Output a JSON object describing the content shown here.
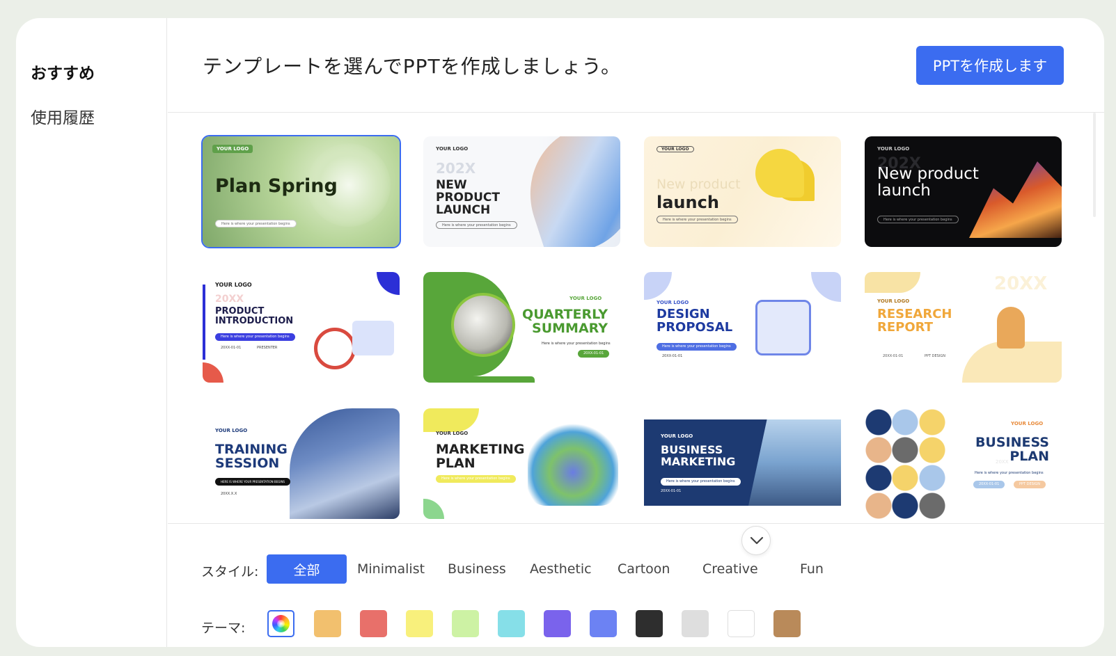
{
  "sidebar": {
    "items": [
      {
        "label": "おすすめ"
      },
      {
        "label": "使用履歴"
      }
    ]
  },
  "header": {
    "title": "テンプレートを選んでPPTを作成しましょう。",
    "create_button": "PPTを作成します"
  },
  "templates": [
    {
      "logo": "YOUR LOGO",
      "title": "Plan Spring",
      "subtitle": "Here is where your presentation begins"
    },
    {
      "logo": "YOUR LOGO",
      "year": "202X",
      "title": "NEW PRODUCT LAUNCH",
      "subtitle": "Here is where your presentation begins"
    },
    {
      "logo": "YOUR LOGO",
      "title_faded": "New product",
      "title": "launch",
      "subtitle": "Here is where your presentation begins"
    },
    {
      "logo": "YOUR LOGO",
      "year": "202X",
      "title": "New product launch",
      "subtitle": "Here is where your presentation begins"
    },
    {
      "logo": "YOUR LOGO",
      "year": "20XX",
      "title": "PRODUCT INTRODUCTION",
      "subtitle": "Here is where your presentation begins",
      "date": "20XX-01-01",
      "presenter": "PRESENTER"
    },
    {
      "logo": "YOUR LOGO",
      "title": "QUARTERLY SUMMARY",
      "subtitle": "Here is where your presentation begins",
      "date": "20XX-01-01"
    },
    {
      "logo": "YOUR LOGO",
      "title": "DESIGN PROPOSAL",
      "subtitle": "Here is where your presentation begins",
      "date": "20XX-01-01"
    },
    {
      "logo": "YOUR LOGO",
      "year": "20XX",
      "title": "RESEARCH REPORT",
      "date": "20XX-01-01",
      "presenter": "PPT DESIGN"
    },
    {
      "logo": "YOUR LOGO",
      "title": "TRAINING SESSION",
      "subtitle": "HERE IS WHERE YOUR PRESENTATION BEGINS",
      "date": "20XX.X.X"
    },
    {
      "logo": "YOUR LOGO",
      "title": "MARKETING PLAN",
      "subtitle": "Here is where your presentation begins"
    },
    {
      "logo": "YOUR LOGO",
      "title": "BUSINESS MARKETING",
      "subtitle": "Here is where your presentation begins",
      "date": "20XX-01-01"
    },
    {
      "logo": "YOUR LOGO",
      "year": "20XX",
      "title": "BUSINESS PLAN",
      "subtitle": "Here is where your presentation begins",
      "date": "20XX-01-01",
      "presenter": "PPT DESIGN"
    }
  ],
  "filters": {
    "style_label": "スタイル:",
    "theme_label": "テーマ:",
    "styles": [
      "全部",
      "Minimalist",
      "Business",
      "Aesthetic",
      "Cartoon",
      "Creative",
      "Fun"
    ],
    "theme_colors": [
      "rainbow",
      "#f2c06e",
      "#e8706a",
      "#f8f07c",
      "#cdf2a4",
      "#86dfe8",
      "#7a63ec",
      "#6c82f3",
      "#2e2e2e",
      "#dedede",
      "#ffffff",
      "#b98a5a"
    ]
  },
  "colors": {
    "accent": "#3b6cf0"
  }
}
